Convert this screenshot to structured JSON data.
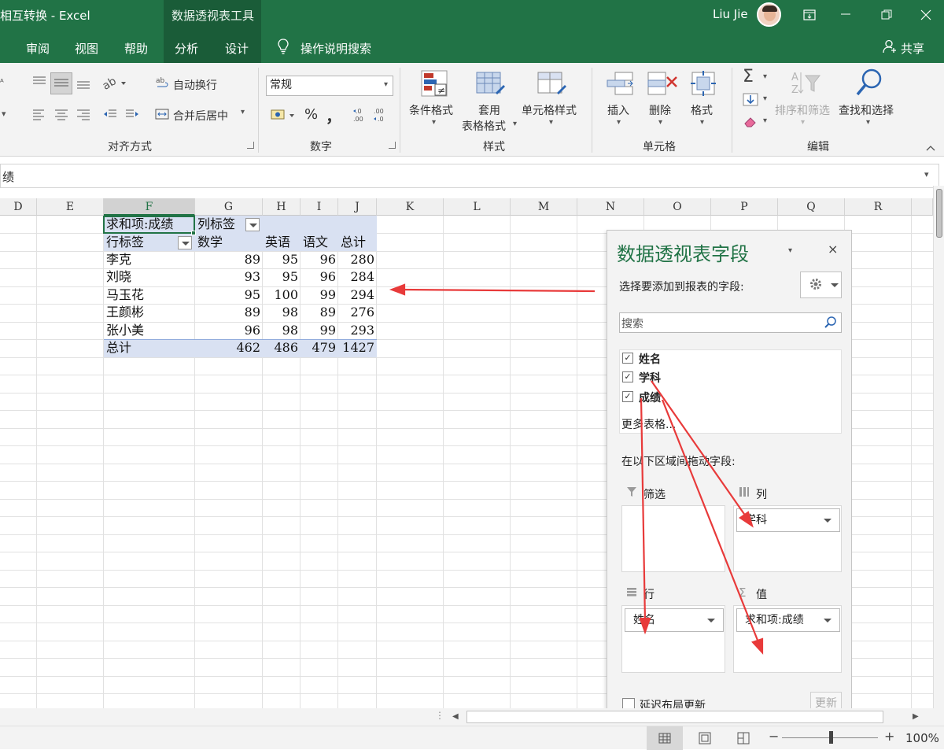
{
  "window": {
    "title": "相互转换  -  Excel",
    "context_tab_group": "数据透视表工具",
    "user": "Liu Jie"
  },
  "tabs": [
    {
      "label": "审阅"
    },
    {
      "label": "视图"
    },
    {
      "label": "帮助"
    },
    {
      "label": "分析",
      "active": true
    },
    {
      "label": "设计"
    },
    {
      "label": "操作说明搜索"
    }
  ],
  "share_label": "共享",
  "ribbon": {
    "alignment": {
      "wrap_text": "自动换行",
      "merge_center": "合并后居中",
      "group_label": "对齐方式"
    },
    "number": {
      "format_value": "常规",
      "percent": "%",
      "comma": "，",
      "group_label": "数字"
    },
    "styles": {
      "conditional": "条件格式",
      "table_format_1": "套用",
      "table_format_2": "表格格式",
      "cell_styles": "单元格样式",
      "group_label": "样式"
    },
    "cells": {
      "insert": "插入",
      "delete": "删除",
      "format": "格式",
      "group_label": "单元格"
    },
    "editing": {
      "sort_filter": "排序和筛选",
      "find_select": "查找和选择",
      "group_label": "编辑",
      "sigma": "Σ"
    }
  },
  "formula_bar": {
    "content": "绩"
  },
  "columns": [
    "D",
    "E",
    "F",
    "G",
    "H",
    "I",
    "J",
    "K",
    "L",
    "M",
    "N",
    "O",
    "P",
    "Q",
    "R"
  ],
  "selected_column": "F",
  "pivot": {
    "header_value_label": "求和项:成绩",
    "col_label": "列标签",
    "row_label": "行标签",
    "subjects": [
      "数学",
      "英语",
      "语文",
      "总计"
    ],
    "rows": [
      {
        "name": "李克",
        "values": [
          "89",
          "95",
          "96",
          "280"
        ]
      },
      {
        "name": "刘晓",
        "values": [
          "93",
          "95",
          "96",
          "284"
        ]
      },
      {
        "name": "马玉花",
        "values": [
          "95",
          "100",
          "99",
          "294"
        ]
      },
      {
        "name": "王颜彬",
        "values": [
          "89",
          "98",
          "89",
          "276"
        ]
      },
      {
        "name": "张小美",
        "values": [
          "96",
          "98",
          "99",
          "293"
        ]
      }
    ],
    "total": {
      "name": "总计",
      "values": [
        "462",
        "486",
        "479",
        "1427"
      ]
    }
  },
  "pane": {
    "title": "数据透视表字段",
    "choose_label": "选择要添加到报表的字段:",
    "search_placeholder": "搜索",
    "fields": [
      {
        "label": "姓名",
        "checked": true
      },
      {
        "label": "学科",
        "checked": true
      },
      {
        "label": "成绩",
        "checked": true
      }
    ],
    "more_tables": "更多表格...",
    "drag_label": "在以下区域间拖动字段:",
    "filter_zone": "筛选",
    "column_zone": "列",
    "row_zone": "行",
    "values_zone": "值",
    "column_item": "学科",
    "row_item": "姓名",
    "values_item": "求和项:成绩",
    "defer_label": "延迟布局更新",
    "update_button": "更新",
    "close": "×"
  },
  "status": {
    "zoom": "100%",
    "plus": "+",
    "minus": "−"
  },
  "colors": {
    "accent": "#217346",
    "annotation_arrow": "#e83a3a",
    "pivot_header_fill": "#d9e1f2"
  }
}
